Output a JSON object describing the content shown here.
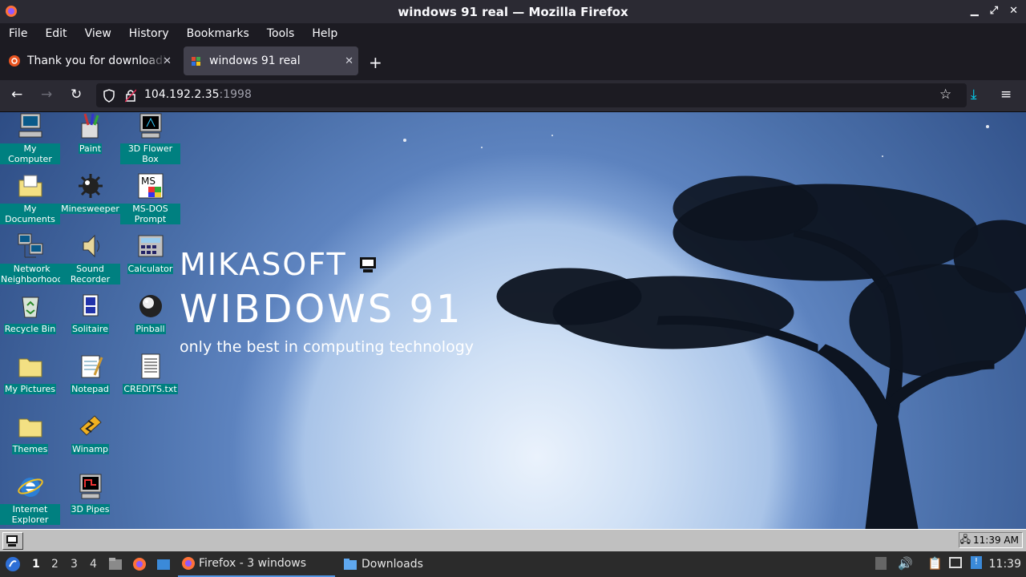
{
  "window": {
    "title": "windows 91 real — Mozilla Firefox"
  },
  "menu": [
    "File",
    "Edit",
    "View",
    "History",
    "Bookmarks",
    "Tools",
    "Help"
  ],
  "tabs": [
    {
      "label": "Thank you for downloadi"
    },
    {
      "label": "windows 91 real"
    }
  ],
  "url": {
    "host": "104.192.2.35",
    "port": ":1998"
  },
  "desktop": {
    "brand_line1": "MIKASOFT",
    "brand_line2": "WIBDOWS 91",
    "brand_line3": "only the best in computing technology",
    "icons": [
      {
        "label": "My Computer",
        "icon": "computer-icon"
      },
      {
        "label": "Paint",
        "icon": "paint-icon"
      },
      {
        "label": "3D Flower Box",
        "icon": "screensaver-icon"
      },
      {
        "label": "My Documents",
        "icon": "folder-documents-icon"
      },
      {
        "label": "Minesweeper",
        "icon": "mine-icon"
      },
      {
        "label": "MS-DOS Prompt",
        "icon": "msdos-icon"
      },
      {
        "label": "Network Neighborhood",
        "icon": "network-icon"
      },
      {
        "label": "Sound Recorder",
        "icon": "speaker-icon"
      },
      {
        "label": "Calculator",
        "icon": "calculator-icon"
      },
      {
        "label": "Recycle Bin",
        "icon": "recycle-bin-icon"
      },
      {
        "label": "Solitaire",
        "icon": "cards-icon"
      },
      {
        "label": "Pinball",
        "icon": "pinball-icon"
      },
      {
        "label": "My Pictures",
        "icon": "folder-icon"
      },
      {
        "label": "Notepad",
        "icon": "notepad-icon"
      },
      {
        "label": "CREDITS.txt",
        "icon": "text-file-icon"
      },
      {
        "label": "Themes",
        "icon": "folder-icon"
      },
      {
        "label": "Winamp",
        "icon": "winamp-icon"
      },
      {
        "label": "Internet Explorer",
        "icon": "ie-icon"
      },
      {
        "label": "3D Pipes",
        "icon": "screensaver-icon"
      }
    ],
    "tray_time": "11:39 AM"
  },
  "panel": {
    "workspaces": [
      "1",
      "2",
      "3",
      "4"
    ],
    "tasks": [
      {
        "label": "Firefox - 3 windows"
      },
      {
        "label": "Downloads"
      }
    ],
    "clock": "11:39"
  }
}
